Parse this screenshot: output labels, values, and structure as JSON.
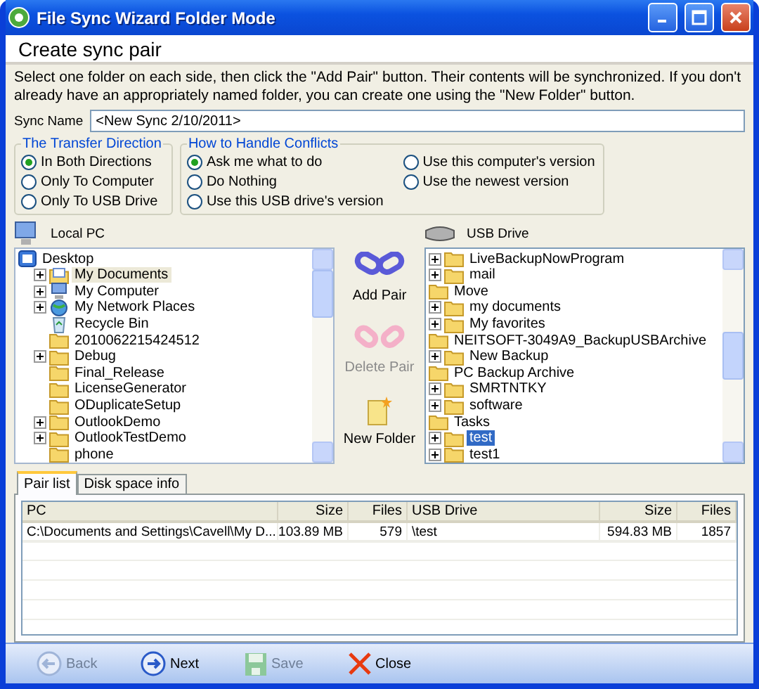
{
  "window": {
    "title": "File Sync Wizard Folder Mode"
  },
  "header": {
    "title": "Create sync pair"
  },
  "description": "Select one folder on each side, then click the \"Add Pair\" button. Their contents will be synchronized.  If you don't already have an appropriately named folder, you can create one using the \"New Folder\" button.",
  "sync_name": {
    "label": "Sync Name",
    "value": "<New Sync 2/10/2011>"
  },
  "transfer_direction": {
    "title": "The Transfer Direction",
    "options": [
      {
        "label": "In Both Directions",
        "selected": true
      },
      {
        "label": "Only To Computer",
        "selected": false
      },
      {
        "label": "Only To USB Drive",
        "selected": false
      }
    ]
  },
  "conflicts": {
    "title": "How to Handle Conflicts",
    "options": [
      {
        "label": "Ask me what to do",
        "selected": true
      },
      {
        "label": "Use this computer's version",
        "selected": false
      },
      {
        "label": "Do Nothing",
        "selected": false
      },
      {
        "label": "Use the newest version",
        "selected": false
      },
      {
        "label": "Use this USB drive's version",
        "selected": false
      }
    ]
  },
  "local_tree": {
    "title": "Local PC",
    "focused": false,
    "items": [
      {
        "label": "Desktop",
        "kind": "desktop",
        "expandable": false,
        "selected": false,
        "children": [
          {
            "label": "My Documents",
            "kind": "documents",
            "expandable": true,
            "selected": true
          },
          {
            "label": "My Computer",
            "kind": "computer",
            "expandable": true,
            "selected": false
          },
          {
            "label": "My Network Places",
            "kind": "network",
            "expandable": true,
            "selected": false
          },
          {
            "label": "Recycle Bin",
            "kind": "recycle",
            "expandable": false,
            "selected": false
          },
          {
            "label": "2010062215424512",
            "kind": "folder",
            "expandable": false,
            "selected": false
          },
          {
            "label": "Debug",
            "kind": "folder",
            "expandable": true,
            "selected": false
          },
          {
            "label": "Final_Release",
            "kind": "folder",
            "expandable": false,
            "selected": false
          },
          {
            "label": "LicenseGenerator",
            "kind": "folder",
            "expandable": false,
            "selected": false
          },
          {
            "label": "ODuplicateSetup",
            "kind": "folder",
            "expandable": false,
            "selected": false
          },
          {
            "label": "OutlookDemo",
            "kind": "folder",
            "expandable": true,
            "selected": false
          },
          {
            "label": "OutlookTestDemo",
            "kind": "folder",
            "expandable": true,
            "selected": false
          },
          {
            "label": "phone",
            "kind": "folder",
            "expandable": false,
            "selected": false
          }
        ]
      }
    ]
  },
  "actions": [
    {
      "label": "Add Pair",
      "disabled": false
    },
    {
      "label": "Delete Pair",
      "disabled": true
    },
    {
      "label": "New Folder",
      "disabled": false
    }
  ],
  "usb_tree": {
    "title": "USB Drive",
    "focused": true,
    "items": [
      {
        "label": "LiveBackupNowProgram",
        "kind": "folder",
        "expandable": true,
        "selected": false
      },
      {
        "label": "mail",
        "kind": "folder",
        "expandable": true,
        "selected": false
      },
      {
        "label": "Move",
        "kind": "folder",
        "expandable": false,
        "selected": false
      },
      {
        "label": "my documents",
        "kind": "folder",
        "expandable": true,
        "selected": false
      },
      {
        "label": "My favorites",
        "kind": "folder",
        "expandable": true,
        "selected": false
      },
      {
        "label": "NEITSOFT-3049A9_BackupUSBArchive",
        "kind": "folder",
        "expandable": false,
        "selected": false
      },
      {
        "label": "New Backup",
        "kind": "folder",
        "expandable": true,
        "selected": false
      },
      {
        "label": "PC Backup Archive",
        "kind": "folder",
        "expandable": false,
        "selected": false
      },
      {
        "label": "SMRTNTKY",
        "kind": "folder",
        "expandable": true,
        "selected": false
      },
      {
        "label": "software",
        "kind": "folder",
        "expandable": true,
        "selected": false
      },
      {
        "label": "Tasks",
        "kind": "folder",
        "expandable": false,
        "selected": false
      },
      {
        "label": "test",
        "kind": "folder",
        "expandable": true,
        "selected": true
      },
      {
        "label": "test1",
        "kind": "folder",
        "expandable": true,
        "selected": false
      }
    ]
  },
  "tabs": [
    {
      "label": "Pair list",
      "selected": true
    },
    {
      "label": "Disk space info",
      "selected": false
    }
  ],
  "table": {
    "columns": [
      {
        "label": "PC",
        "kind": "text"
      },
      {
        "label": "Size",
        "kind": "number"
      },
      {
        "label": "Files",
        "kind": "number"
      },
      {
        "label": "USB Drive",
        "kind": "text"
      },
      {
        "label": "Size",
        "kind": "number"
      },
      {
        "label": "Files",
        "kind": "number"
      }
    ],
    "rows": [
      [
        "C:\\Documents and Settings\\Cavell\\My D...",
        "103.89 MB",
        "579",
        "\\test",
        "594.83 MB",
        "1857"
      ]
    ]
  },
  "footer_buttons": [
    {
      "label": "Back",
      "disabled": true
    },
    {
      "label": "Next",
      "disabled": false
    },
    {
      "label": "Save",
      "disabled": true
    },
    {
      "label": "Close",
      "disabled": false
    }
  ]
}
